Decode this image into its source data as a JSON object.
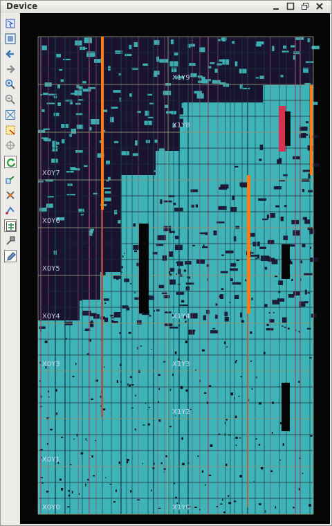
{
  "window": {
    "title": "Device",
    "buttons": [
      "minimize-icon",
      "maximize-icon",
      "restore-icon",
      "close-icon"
    ]
  },
  "toolbar": [
    {
      "name": "tool-select",
      "icon": "select-icon"
    },
    {
      "name": "tool-fit",
      "icon": "fit-icon"
    },
    {
      "name": "tool-back",
      "icon": "arrow-left-icon"
    },
    {
      "name": "tool-forward",
      "icon": "arrow-right-icon"
    },
    {
      "name": "tool-zoom-in",
      "icon": "zoom-in-icon"
    },
    {
      "name": "tool-zoom-out",
      "icon": "zoom-out-icon"
    },
    {
      "name": "tool-zoom-fit",
      "icon": "zoom-fit-icon"
    },
    {
      "name": "tool-pblock",
      "icon": "pblock-icon"
    },
    {
      "name": "tool-auto-fit",
      "icon": "crosshair-icon"
    },
    {
      "name": "tool-refresh",
      "icon": "refresh-icon",
      "active": true
    },
    {
      "name": "tool-route",
      "icon": "route-icon"
    },
    {
      "name": "tool-routing-resources",
      "icon": "routing-resources-icon"
    },
    {
      "name": "tool-nets",
      "icon": "nets-icon"
    },
    {
      "name": "tool-show-connections",
      "icon": "connections-icon",
      "active": true
    },
    {
      "name": "tool-pin",
      "icon": "pin-icon"
    },
    {
      "name": "tool-draw",
      "icon": "pencil-icon",
      "active": true
    }
  ],
  "clock_regions": [
    {
      "label": "X1Y9",
      "col": 1,
      "row": 9
    },
    {
      "label": "X1Y8",
      "col": 1,
      "row": 8
    },
    {
      "label": "X0Y7",
      "col": 0,
      "row": 7
    },
    {
      "label": "X0Y6",
      "col": 0,
      "row": 6
    },
    {
      "label": "X0Y5",
      "col": 0,
      "row": 5
    },
    {
      "label": "X0Y4",
      "col": 0,
      "row": 4
    },
    {
      "label": "X1Y4",
      "col": 1,
      "row": 4
    },
    {
      "label": "X0Y3",
      "col": 0,
      "row": 3
    },
    {
      "label": "X1Y3",
      "col": 1,
      "row": 3
    },
    {
      "label": "X1Y2",
      "col": 1,
      "row": 2
    },
    {
      "label": "X0Y1",
      "col": 0,
      "row": 1
    },
    {
      "label": "X0Y0",
      "col": 0,
      "row": 0
    },
    {
      "label": "X1Y0",
      "col": 1,
      "row": 0
    }
  ],
  "colors": {
    "background": "#060606",
    "cell_fill": "#3fb4b8",
    "grid_line": "#8a5070",
    "cursor_line": "#ff7a10",
    "region_border": "#c8c890",
    "empty_region": "#1a1330"
  }
}
